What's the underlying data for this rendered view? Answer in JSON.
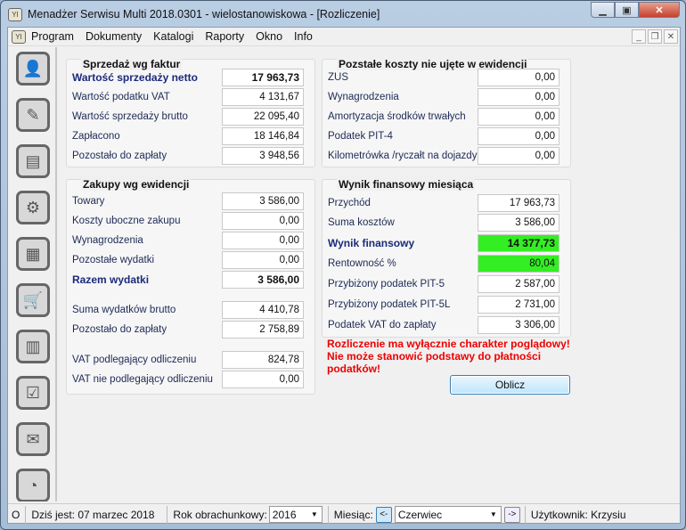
{
  "window": {
    "title": "Menadżer Serwisu Multi 2018.0301 - wielostanowiskowa - [Rozliczenie]",
    "app_icon": "YI"
  },
  "menu": [
    "Program",
    "Dokumenty",
    "Katalogi",
    "Raporty",
    "Okno",
    "Info"
  ],
  "toolbar_icons": [
    "client-icon",
    "vat-invoice-icon",
    "document-icon",
    "service-settings-icon",
    "warehouse-icon",
    "cart-icon",
    "binders-icon",
    "checklist-icon",
    "payment-icon",
    "pie-chart-icon"
  ],
  "sales": {
    "title": "Sprzedaż wg faktur",
    "rows": [
      {
        "label": "Wartość sprzedaży netto",
        "value": "17 963,73",
        "bold": true
      },
      {
        "label": "Wartość podatku VAT",
        "value": "4 131,67"
      },
      {
        "label": "Wartość sprzedaży brutto",
        "value": "22 095,40"
      },
      {
        "label": "Zapłacono",
        "value": "18 146,84"
      },
      {
        "label": "Pozostało do zapłaty",
        "value": "3 948,56"
      }
    ]
  },
  "purchases": {
    "title": "Zakupy wg ewidencji",
    "rows": [
      {
        "label": "Towary",
        "value": "3 586,00"
      },
      {
        "label": "Koszty uboczne zakupu",
        "value": "0,00"
      },
      {
        "label": "Wynagrodzenia",
        "value": "0,00"
      },
      {
        "label": "Pozostałe wydatki",
        "value": "0,00"
      },
      {
        "label": "Razem wydatki",
        "value": "3 586,00",
        "bold": true
      },
      {
        "label": "Suma wydatków brutto",
        "value": "4 410,78"
      },
      {
        "label": "Pozostało do zapłaty",
        "value": "2 758,89"
      },
      {
        "label": "VAT podlegający odliczeniu",
        "value": "824,78"
      },
      {
        "label": "VAT nie podlegający odliczeniu",
        "value": "0,00"
      }
    ]
  },
  "other_costs": {
    "title": "Pozstałe koszty nie ujęte w ewidencji",
    "rows": [
      {
        "label": "ZUS",
        "value": "0,00"
      },
      {
        "label": "Wynagrodzenia",
        "value": "0,00"
      },
      {
        "label": "Amortyzacja środków trwałych",
        "value": "0,00"
      },
      {
        "label": "Podatek PIT-4",
        "value": "0,00"
      },
      {
        "label": "Kilometrówka /ryczałt na dojazdy",
        "value": "0,00"
      }
    ]
  },
  "result": {
    "title": "Wynik finansowy miesiąca",
    "rows": [
      {
        "label": "Przychód",
        "value": "17 963,73"
      },
      {
        "label": "Suma kosztów",
        "value": "3 586,00"
      },
      {
        "label": "Wynik finansowy",
        "value": "14 377,73",
        "bold": true,
        "highlight": "#33ee22"
      },
      {
        "label": "Rentowność %",
        "value": "80,04",
        "highlight": "#33ee22"
      },
      {
        "label": "Przybiżony podatek PIT-5",
        "value": "2 587,00"
      },
      {
        "label": "Przybiżony podatek PIT-5L",
        "value": "2 731,00"
      },
      {
        "label": "Podatek VAT do zapłaty",
        "value": "3 306,00"
      }
    ]
  },
  "warning": [
    "Rozliczenie ma wyłącznie charakter poglądowy!",
    "Nie może stanowić podstawy do płatności",
    "podatków!"
  ],
  "calc_button": "Oblicz",
  "status": {
    "indicator": "O",
    "today": "Dziś jest: 07 marzec 2018",
    "year_label": "Rok obrachunkowy:",
    "year": "2016",
    "month_label": "Miesiąc:",
    "prev": "<-",
    "month": "Czerwiec",
    "next": "->",
    "user": "Użytkownik: Krzysiu"
  }
}
